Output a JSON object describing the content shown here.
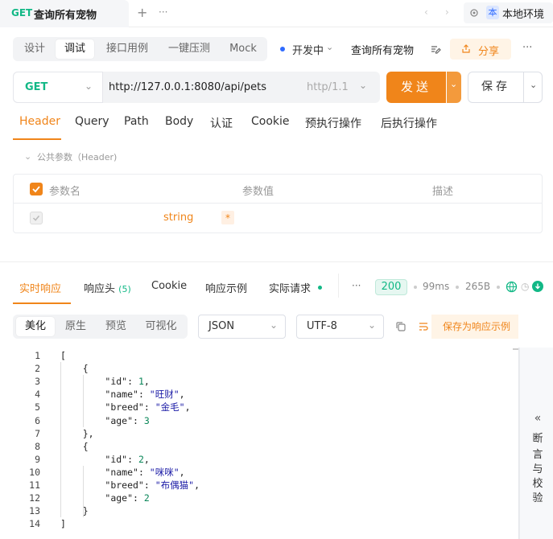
{
  "tabs": {
    "active_method": "GET",
    "active_title": "查询所有宠物",
    "add_icon": "+",
    "more_icon": "···",
    "env_badge": "本",
    "env_label": "本地环境"
  },
  "mode_tabs": [
    {
      "label": "设计"
    },
    {
      "label": "调试"
    },
    {
      "label": "接口用例"
    },
    {
      "label": "一键压测"
    },
    {
      "label": "Mock"
    }
  ],
  "status": {
    "label": "开发中",
    "dot_color": "#2f6bff"
  },
  "api_name": "查询所有宠物",
  "share_label": "分享",
  "request": {
    "method": "GET",
    "url": "http://127.0.0.1:8080/api/pets",
    "protocol": "http/1.1",
    "send_label": "发送",
    "save_label": "保存"
  },
  "request_tabs": [
    "Header",
    "Query",
    "Path",
    "Body",
    "认证",
    "Cookie",
    "预执行操作",
    "后执行操作"
  ],
  "public_params_label": "公共参数（Header)",
  "param_table": {
    "col_name": "参数名",
    "col_value": "参数值",
    "col_desc": "描述",
    "row_type": "string",
    "row_required": "*"
  },
  "response_tabs": {
    "realtime": "实时响应",
    "headers": "响应头",
    "headers_count": "(5)",
    "cookie": "Cookie",
    "example": "响应示例",
    "actual": "实际请求"
  },
  "response_meta": {
    "status_code": "200",
    "time": "99ms",
    "size": "265B"
  },
  "view_tabs": [
    "美化",
    "原生",
    "预览",
    "可视化"
  ],
  "format_select": "JSON",
  "encoding_select": "UTF-8",
  "save_sample_label": "保存为响应示例",
  "code_lines": [
    {
      "n": "1",
      "text": "["
    },
    {
      "n": "2",
      "text": "    {"
    },
    {
      "n": "3",
      "key": "\"id\"",
      "sep": ": ",
      "val": "1",
      "vtype": "num",
      "tail": ","
    },
    {
      "n": "4",
      "key": "\"name\"",
      "sep": ": ",
      "val": "\"旺财\"",
      "vtype": "str",
      "tail": ","
    },
    {
      "n": "5",
      "key": "\"breed\"",
      "sep": ": ",
      "val": "\"金毛\"",
      "vtype": "str",
      "tail": ","
    },
    {
      "n": "6",
      "key": "\"age\"",
      "sep": ": ",
      "val": "3",
      "vtype": "num",
      "tail": ""
    },
    {
      "n": "7",
      "text": "    },"
    },
    {
      "n": "8",
      "text": "    {"
    },
    {
      "n": "9",
      "key": "\"id\"",
      "sep": ": ",
      "val": "2",
      "vtype": "num",
      "tail": ","
    },
    {
      "n": "10",
      "key": "\"name\"",
      "sep": ": ",
      "val": "\"咪咪\"",
      "vtype": "str",
      "tail": ","
    },
    {
      "n": "11",
      "key": "\"breed\"",
      "sep": ": ",
      "val": "\"布偶猫\"",
      "vtype": "str",
      "tail": ","
    },
    {
      "n": "12",
      "key": "\"age\"",
      "sep": ": ",
      "val": "2",
      "vtype": "num",
      "tail": ""
    },
    {
      "n": "13",
      "text": "    }"
    },
    {
      "n": "14",
      "text": "]"
    }
  ],
  "side_panel": {
    "chevron": "«",
    "chars": [
      "断",
      "言",
      "与",
      "校",
      "验"
    ]
  },
  "colors": {
    "accent": "#f0851a",
    "success": "#12b886",
    "status_dot": "#2f6bff"
  }
}
